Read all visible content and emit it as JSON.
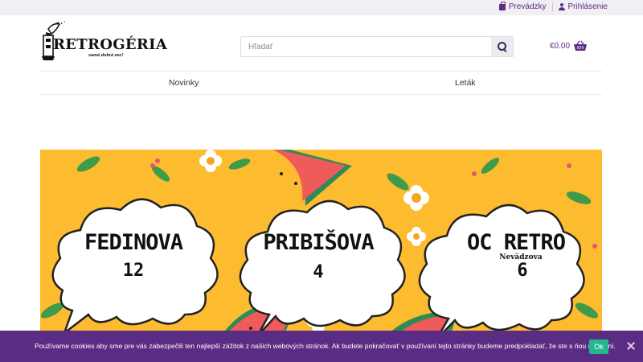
{
  "topbar": {
    "stores_label": "Prevádzky",
    "login_label": "Prihlásenie"
  },
  "logo": {
    "name": "RETROGÉRIA",
    "tagline": "samá dobrá vec!"
  },
  "search": {
    "placeholder": "Hľadať"
  },
  "cart": {
    "total": "€0.00"
  },
  "nav": {
    "items": [
      {
        "label": "Novinky"
      },
      {
        "label": "Leták"
      }
    ]
  },
  "banner": {
    "stores": [
      {
        "title": "FEDINOVA",
        "number": "12"
      },
      {
        "title": "PRIBIŠOVA",
        "number": "4"
      },
      {
        "title": "OC RETRO",
        "subtitle": "Nevädzova",
        "number": "6"
      }
    ]
  },
  "cookie": {
    "message": "Používame cookies aby sme pre vás zabezpečili ten najlepší zážitok z našich webových stránok. Ak budete pokračovať v používaní tejto stránky budeme predpokladať, že ste s ňou spokojní.",
    "ok_label": "Ok"
  },
  "colors": {
    "brand": "#5b2c83",
    "banner_bg": "#fdbb2f",
    "ok_button": "#22b88f"
  }
}
